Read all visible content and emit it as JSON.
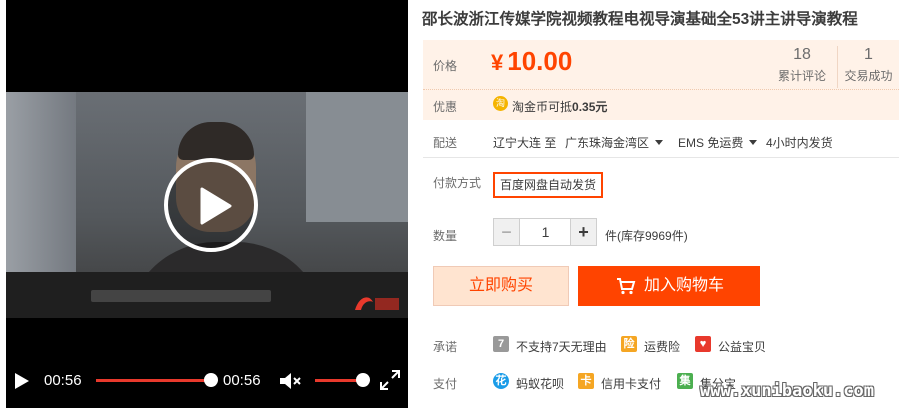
{
  "player": {
    "current_time": "00:56",
    "duration": "00:56",
    "progress": 1.0,
    "volume": 1.0,
    "video_watermark_colors": [
      "#e8392c"
    ]
  },
  "product": {
    "title": "邵长波浙江传媒学院视频教程电视导演基础全53讲主讲导演教程",
    "price": {
      "label": "价格",
      "currency": "¥",
      "value": "10.00"
    },
    "stats": [
      {
        "num": "18",
        "label": "累计评论"
      },
      {
        "num": "1",
        "label": "交易成功"
      }
    ],
    "promo": {
      "label": "优惠",
      "coin_icon": "淘",
      "text": "淘金币可抵",
      "amount": "0.35元"
    },
    "shipping": {
      "label": "配送",
      "from": "辽宁大连 至",
      "to": "广东珠海金湾区",
      "method": "EMS 免运费",
      "dispatch": "4小时内发货"
    },
    "payment_method": {
      "label": "付款方式",
      "option": "百度网盘自动发货"
    },
    "quantity": {
      "label": "数量",
      "minus": "−",
      "value": "1",
      "plus": "+",
      "stock": "件(库存9969件)"
    },
    "buttons": {
      "buy_now": "立即购买",
      "add_to_cart": "加入购物车"
    },
    "promise": {
      "label": "承诺",
      "items": [
        {
          "icon": "7",
          "icon_color": "#999999",
          "text": "不支持7天无理由"
        },
        {
          "icon": "险",
          "icon_color": "#f5a623",
          "text": "运费险"
        },
        {
          "icon": "♥",
          "icon_color": "#e8392c",
          "text": "公益宝贝"
        }
      ]
    },
    "pay": {
      "label": "支付",
      "items": [
        {
          "icon": "花",
          "icon_color": "#1a9ce8",
          "text": "蚂蚁花呗"
        },
        {
          "icon": "卡",
          "icon_color": "#f5a623",
          "text": "信用卡支付"
        },
        {
          "icon": "集",
          "icon_color": "#4caf50",
          "text": "集分宝"
        }
      ]
    }
  },
  "watermark": "www.xunibaoku.com",
  "colors": {
    "accent": "#ff4400",
    "price_bg": "#fff2e8",
    "buy_bg": "#ffe4d0"
  }
}
